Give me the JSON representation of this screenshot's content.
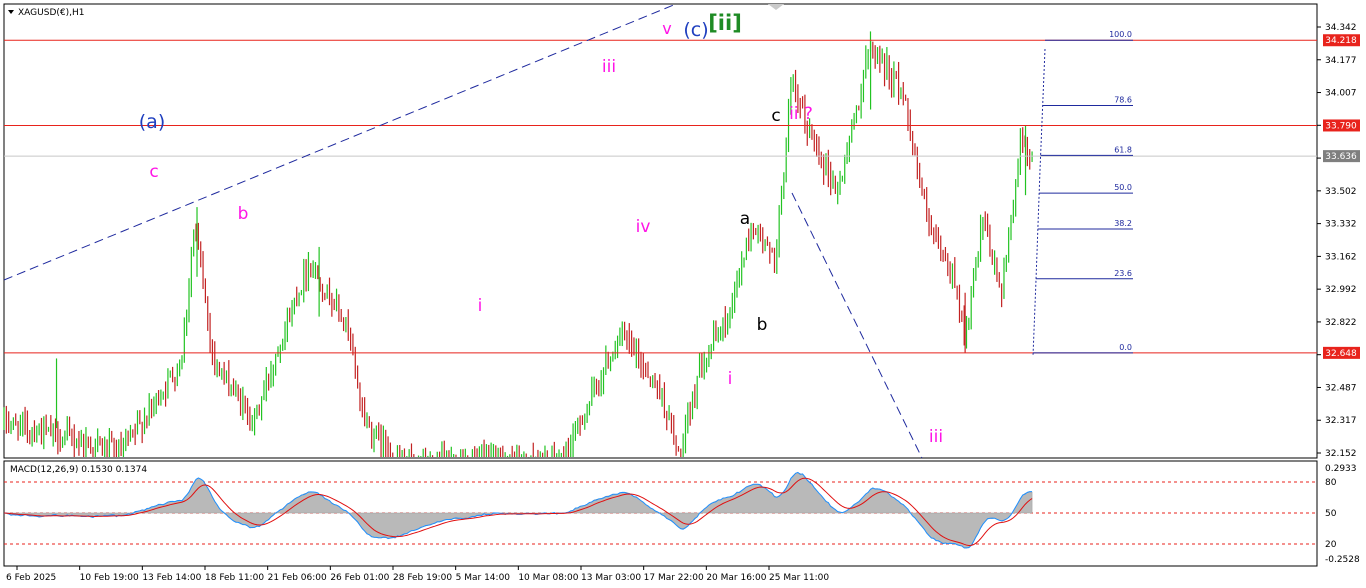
{
  "header": {
    "symbol_title": "XAGUSD(€),H1",
    "indicator_title": "MACD(12,26,9) 0.1530 0.1374"
  },
  "price_axis": {
    "labels": [
      "34.342",
      "34.177",
      "34.007",
      "33.837",
      "33.667",
      "33.502",
      "33.332",
      "33.162",
      "32.992",
      "32.822",
      "32.652",
      "32.487",
      "32.317",
      "32.152"
    ],
    "badges": [
      {
        "name": "resistance-upper",
        "text": "34.218",
        "value": 34.218,
        "color": "#e8231c"
      },
      {
        "name": "resistance-mid",
        "text": "33.790",
        "value": 33.79,
        "color": "#e8231c"
      },
      {
        "name": "current-price",
        "text": "33.636",
        "value": 33.636,
        "color": "#7f7f7f"
      },
      {
        "name": "support",
        "text": "32.648",
        "value": 32.648,
        "color": "#e8231c"
      }
    ]
  },
  "macd_axis": {
    "labels": [
      "0.2933",
      "80",
      "50",
      "20",
      "-0.2528"
    ]
  },
  "time_axis": {
    "labels": [
      "6 Feb 2025",
      "10 Feb 19:00",
      "13 Feb 14:00",
      "18 Feb 11:00",
      "21 Feb 06:00",
      "26 Feb 01:00",
      "28 Feb 19:00",
      "5 Mar 14:00",
      "10 Mar 08:00",
      "13 Mar 03:00",
      "17 Mar 22:00",
      "20 Mar 16:00",
      "25 Mar 11:00"
    ]
  },
  "fib_levels": [
    "100.0",
    "78.6",
    "61.8",
    "50.0",
    "38.2",
    "23.6",
    "0.0"
  ],
  "wave_labels": [
    {
      "name": "wave-a-degree",
      "text": "(a)",
      "color": "#1f3fbf"
    },
    {
      "name": "wave-c-left",
      "text": "c",
      "color": "#ff14e6"
    },
    {
      "name": "wave-b-left",
      "text": "b",
      "color": "#ff14e6"
    },
    {
      "name": "wave-i-first",
      "text": "i",
      "color": "#ff14e6"
    },
    {
      "name": "wave-iii-top",
      "text": "iii",
      "color": "#ff14e6"
    },
    {
      "name": "wave-iv",
      "text": "iv",
      "color": "#ff14e6"
    },
    {
      "name": "wave-v",
      "text": "v",
      "color": "#ff14e6"
    },
    {
      "name": "wave-c-degree",
      "text": "(c)",
      "color": "#1f3fbf"
    },
    {
      "name": "wave-ii-bracket",
      "text": "[ii]",
      "color": "#1e8b24"
    },
    {
      "name": "wave-i-low",
      "text": "i",
      "color": "#ff14e6"
    },
    {
      "name": "wave-a-small",
      "text": "a",
      "color": "#000000"
    },
    {
      "name": "wave-b-small",
      "text": "b",
      "color": "#000000"
    },
    {
      "name": "wave-c-small",
      "text": "c",
      "color": "#000000"
    },
    {
      "name": "wave-ii-question",
      "text": "ii ?",
      "color": "#ff14e6"
    },
    {
      "name": "wave-iii-projected",
      "text": "iii",
      "color": "#ff14e6"
    }
  ],
  "colors": {
    "up": "#22c322",
    "down": "#c22222",
    "level_line": "#e8231c",
    "trend_line": "#1f2a9e",
    "macd_line": "#1e90ff",
    "signal_line": "#e01010",
    "hist": "#b9b9b9"
  },
  "chart_data": {
    "type": "candlestick",
    "symbol": "XAGUSD(€)",
    "timeframe": "H1",
    "y_range": [
      32.12,
      34.4
    ],
    "horizontal_levels": [
      34.218,
      33.79,
      32.648
    ],
    "current_price": 33.636,
    "fibonacci": [
      {
        "ratio": "100.0",
        "price": 34.218
      },
      {
        "ratio": "78.6",
        "price": 33.89
      },
      {
        "ratio": "61.8",
        "price": 33.64
      },
      {
        "ratio": "50.0",
        "price": 33.45
      },
      {
        "ratio": "38.2",
        "price": 33.27
      },
      {
        "ratio": "23.6",
        "price": 33.02
      },
      {
        "ratio": "0.0",
        "price": 32.648
      }
    ],
    "path": [
      {
        "t": 0,
        "p": 32.3
      },
      {
        "t": 0.09,
        "p": 32.15
      },
      {
        "t": 0.135,
        "p": 32.6
      },
      {
        "t": 0.145,
        "p": 33.3
      },
      {
        "t": 0.16,
        "p": 32.6
      },
      {
        "t": 0.19,
        "p": 32.3
      },
      {
        "t": 0.21,
        "p": 32.7
      },
      {
        "t": 0.232,
        "p": 33.1
      },
      {
        "t": 0.26,
        "p": 32.8
      },
      {
        "t": 0.275,
        "p": 32.3
      },
      {
        "t": 0.3,
        "p": 32.1
      },
      {
        "t": 0.425,
        "p": 32.1
      },
      {
        "t": 0.47,
        "p": 32.75
      },
      {
        "t": 0.5,
        "p": 32.45
      },
      {
        "t": 0.515,
        "p": 32.1
      },
      {
        "t": 0.53,
        "p": 32.6
      },
      {
        "t": 0.55,
        "p": 32.8
      },
      {
        "t": 0.57,
        "p": 33.3
      },
      {
        "t": 0.587,
        "p": 33.1
      },
      {
        "t": 0.6,
        "p": 34.0
      },
      {
        "t": 0.61,
        "p": 33.8
      },
      {
        "t": 0.635,
        "p": 33.45
      },
      {
        "t": 0.66,
        "p": 34.2
      },
      {
        "t": 0.685,
        "p": 33.95
      },
      {
        "t": 0.705,
        "p": 33.25
      },
      {
        "t": 0.725,
        "p": 33.0
      },
      {
        "t": 0.732,
        "p": 32.7
      },
      {
        "t": 0.745,
        "p": 33.3
      },
      {
        "t": 0.76,
        "p": 32.95
      },
      {
        "t": 0.775,
        "p": 33.75
      },
      {
        "t": 0.783,
        "p": 33.6
      }
    ],
    "macd_range": [
      -0.2528,
      0.2933
    ],
    "macd_value": 0.153,
    "signal_value": 0.1374
  }
}
